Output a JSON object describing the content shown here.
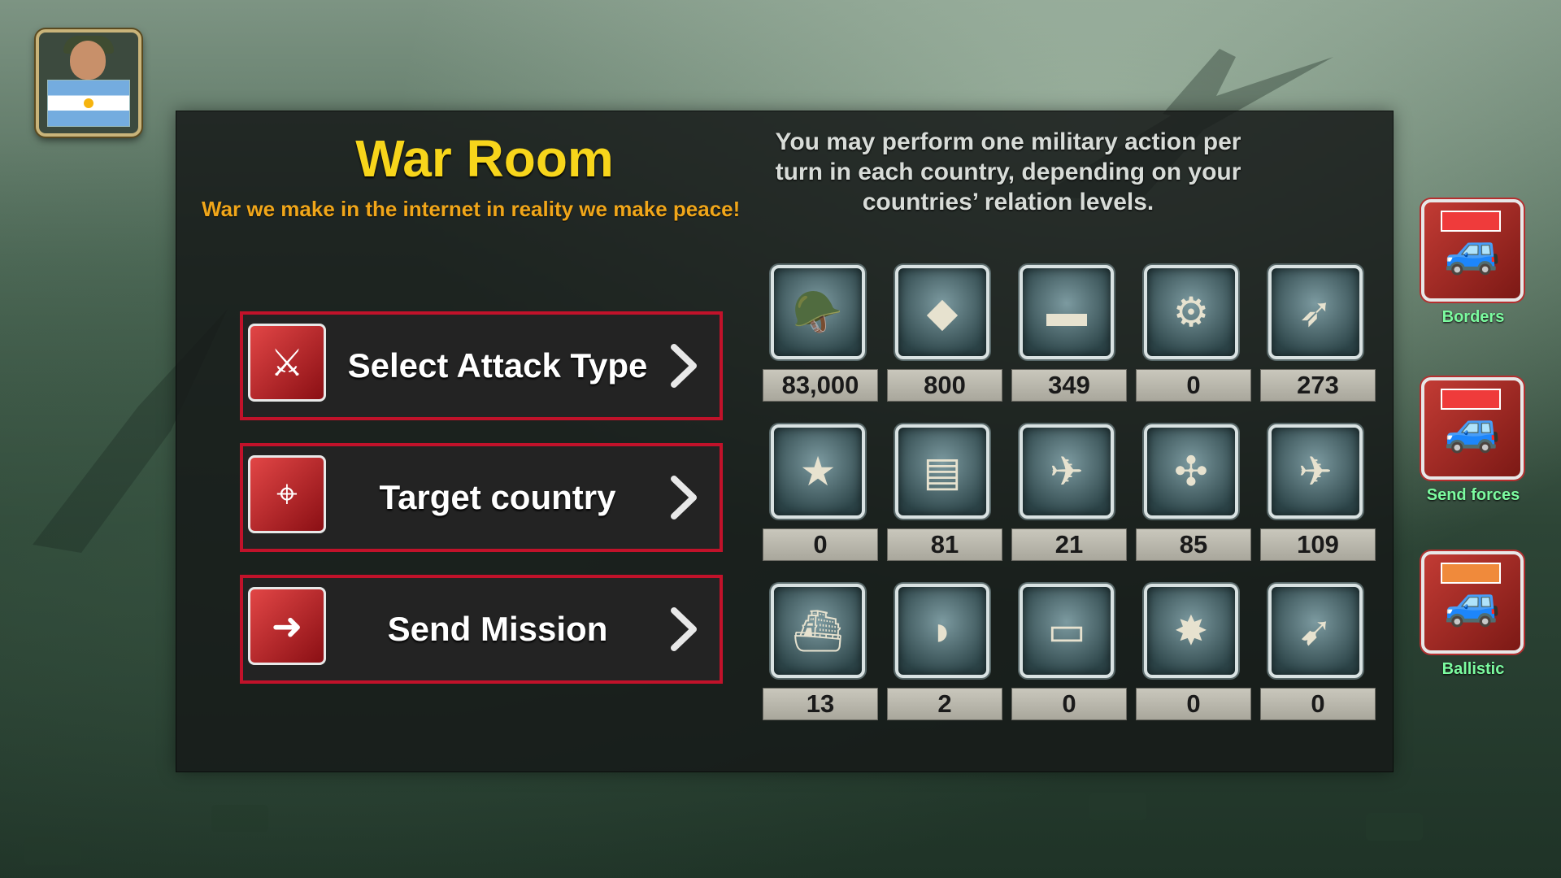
{
  "header": {
    "title": "War Room",
    "subtitle": "War we make in the internet in reality we make peace!",
    "info": "You may perform one military action per turn in each country, depending on your countries’ relation levels."
  },
  "player": {
    "icon": "general-portrait-icon",
    "flag": "argentina-flag"
  },
  "actions": [
    {
      "label": "Select Attack Type",
      "icon": "attack-type-icon"
    },
    {
      "label": "Target country",
      "icon": "target-map-icon"
    },
    {
      "label": "Send Mission",
      "icon": "send-mission-icon"
    }
  ],
  "units": [
    {
      "icon": "infantry-soldier-icon",
      "count": "83,000"
    },
    {
      "icon": "armored-vehicle-icon",
      "count": "800"
    },
    {
      "icon": "tank-icon",
      "count": "349"
    },
    {
      "icon": "robot-tank-icon",
      "count": "0"
    },
    {
      "icon": "artillery-icon",
      "count": "273"
    },
    {
      "icon": "general-officer-icon",
      "count": "0"
    },
    {
      "icon": "missile-launcher-truck-icon",
      "count": "81"
    },
    {
      "icon": "drone-icon",
      "count": "21"
    },
    {
      "icon": "attack-helicopter-icon",
      "count": "85"
    },
    {
      "icon": "fighter-jet-icon",
      "count": "109"
    },
    {
      "icon": "warship-icon",
      "count": "13"
    },
    {
      "icon": "submarine-icon",
      "count": "2"
    },
    {
      "icon": "aircraft-carrier-icon",
      "count": "0"
    },
    {
      "icon": "ballistic-missile-launcher-icon",
      "count": "0"
    },
    {
      "icon": "missiles-icon",
      "count": "0"
    }
  ],
  "side_buttons": [
    {
      "label": "Borders",
      "icon": "borders-icon"
    },
    {
      "label": "Send forces",
      "icon": "send-forces-icon"
    },
    {
      "label": "Ballistic",
      "icon": "ballistic-icon"
    }
  ]
}
